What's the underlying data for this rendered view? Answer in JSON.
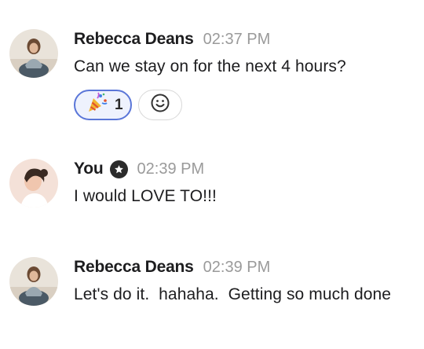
{
  "messages": [
    {
      "author": "Rebecca Deans",
      "time": "02:37 PM",
      "text": "Can we stay on for the next 4 hours?",
      "avatar_icon": "person-avatar",
      "reactions": [
        {
          "icon": "party-popper-icon",
          "emoji": "🎉",
          "count": "1"
        }
      ]
    },
    {
      "author": "You",
      "time": "02:39 PM",
      "text": "I would LOVE TO!!!",
      "avatar_icon": "person-avatar",
      "badge_icon": "star-badge-icon"
    },
    {
      "author": "Rebecca Deans",
      "time": "02:39 PM",
      "text": "Let's do it.  hahaha.  Getting so much done",
      "avatar_icon": "person-avatar"
    }
  ],
  "colors": {
    "reaction_border": "#5a76d8",
    "reaction_bg": "#eef2fd",
    "timestamp": "#9a9a9a",
    "badge": "#2b2b2b"
  }
}
